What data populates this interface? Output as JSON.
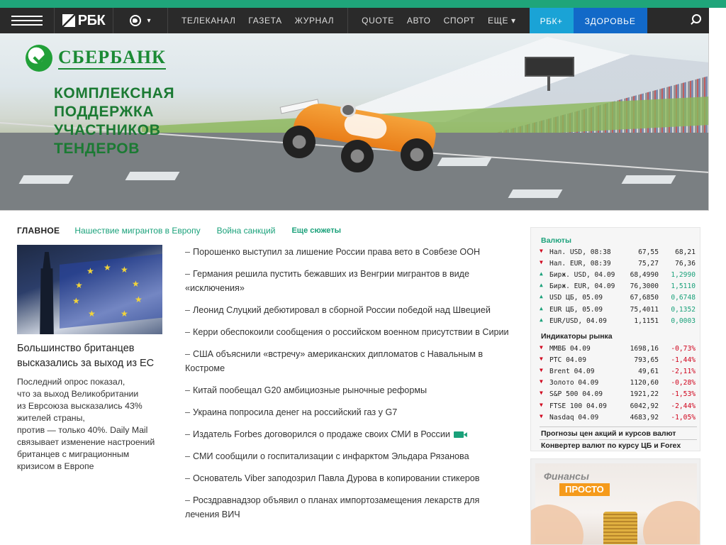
{
  "nav": {
    "logo": "РБК",
    "geo_caret": "▾",
    "items": [
      "ТЕЛЕКАНАЛ",
      "ГАЗЕТА",
      "ЖУРНАЛ"
    ],
    "items2": [
      "QUOTE",
      "АВТО",
      "СПОРТ",
      "ЕЩЕ ▾"
    ],
    "plus": "РБК+",
    "health": "ЗДОРОВЬЕ"
  },
  "banner": {
    "brand": "СБЕРБАНК",
    "slogan": "КОМПЛЕКСНАЯ\nПОДДЕРЖКА\nУЧАСТНИКОВ\nТЕНДЕРОВ"
  },
  "tabs": {
    "main": "ГЛАВНОЕ",
    "links": [
      "Нашествие мигрантов в Европу",
      "Война санкций"
    ],
    "more": "Еще сюжеты"
  },
  "feature": {
    "title": "Большинство британцев высказались за выход из ЕС",
    "text": "Последний опрос показал,\nчто за выход Великобритании\nиз Еврсоюза высказались 43%\nжителей страны,\nпротив — только 40%. Daily Mail\nсвязывает изменение настроений\nбританцев с миграционным\nкризисом в Европе"
  },
  "news": [
    "Порошенко выступил за лишение России права вето в Совбезе ООН",
    "Германия решила пустить бежавших из Венгрии мигрантов в виде «исключения»",
    "Леонид Слуцкий дебютировал в сборной России победой над Швецией",
    "Керри обеспокоили сообщения о российском военном присутствии в Сирии",
    "США объяснили «встречу» американских дипломатов с Навальным в Костроме",
    "Китай пообещал G20 амбициозные рыночные реформы",
    "Украина попросила денег на российский газ у G7",
    "Издатель Forbes договорился о продаже своих СМИ в России",
    "СМИ сообщили о госпитализации с инфарктом Эльдара Рязанова",
    "Основатель Viber заподозрил Павла Дурова в копировании стикеров",
    "Росздравнадзор объявил о планах импортозамещения лекарств для лечения ВИЧ"
  ],
  "market": {
    "currency_header": "Валюты",
    "currencies": [
      {
        "dir": "down",
        "name": "Нал. USD, 08:38",
        "v1": "67,55",
        "v2": "68,21"
      },
      {
        "dir": "down",
        "name": "Нал. EUR, 08:39",
        "v1": "75,27",
        "v2": "76,36"
      },
      {
        "dir": "up",
        "name": "Бирж. USD, 04.09",
        "v1": "68,4990",
        "v2": "1,2990"
      },
      {
        "dir": "up",
        "name": "Бирж. EUR, 04.09",
        "v1": "76,3000",
        "v2": "1,5110"
      },
      {
        "dir": "up",
        "name": "USD ЦБ, 05.09",
        "v1": "67,6850",
        "v2": "0,6748"
      },
      {
        "dir": "up",
        "name": "EUR ЦБ, 05.09",
        "v1": "75,4011",
        "v2": "0,1352"
      },
      {
        "dir": "up",
        "name": "EUR/USD, 04.09",
        "v1": "1,1151",
        "v2": "0,0003"
      }
    ],
    "indicators_header": "Индикаторы рынка",
    "indicators": [
      {
        "dir": "down",
        "name": "ММВБ 04.09",
        "v1": "1698,16",
        "v2": "-0,73%"
      },
      {
        "dir": "down",
        "name": "РТС 04.09",
        "v1": "793,65",
        "v2": "-1,44%"
      },
      {
        "dir": "down",
        "name": "Brent 04.09",
        "v1": "49,61",
        "v2": "-2,11%"
      },
      {
        "dir": "down",
        "name": "Золото 04.09",
        "v1": "1120,60",
        "v2": "-0,28%"
      },
      {
        "dir": "down",
        "name": "S&P 500 04.09",
        "v1": "1921,22",
        "v2": "-1,53%"
      },
      {
        "dir": "down",
        "name": "FTSE 100 04.09",
        "v1": "6042,92",
        "v2": "-2,44%"
      },
      {
        "dir": "down",
        "name": "Nasdaq 04.09",
        "v1": "4683,92",
        "v2": "-1,05%"
      }
    ],
    "link1": "Прогнозы цен акций и курсов валют",
    "link2": "Конвертер валют по курсу ЦБ и Forex"
  },
  "promo": {
    "line1": "Финансы",
    "line2": "ПРОСТО"
  },
  "colors": {
    "accent": "#1aa17a",
    "negative": "#d0021b",
    "nav_bg": "#2a2a2a",
    "plus_bg": "#1aa3d6",
    "health_bg": "#1269c8"
  }
}
